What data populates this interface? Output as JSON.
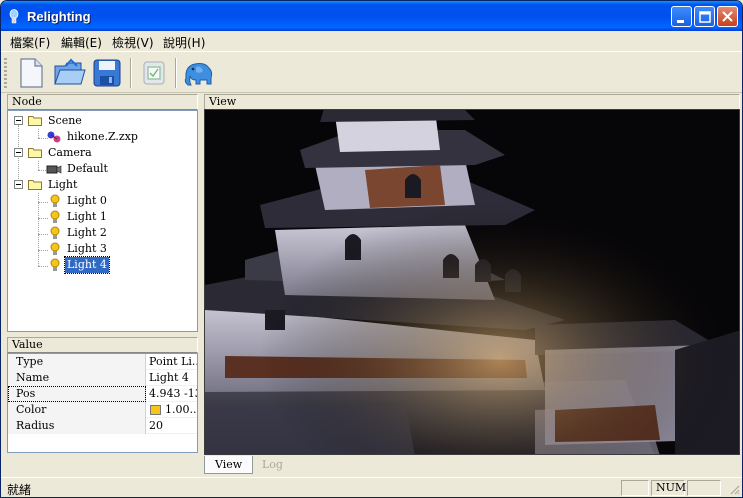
{
  "window": {
    "title": "Relighting"
  },
  "menu": {
    "items": [
      {
        "label": "檔案(F)"
      },
      {
        "label": "編輯(E)"
      },
      {
        "label": "檢視(V)"
      },
      {
        "label": "說明(H)"
      }
    ]
  },
  "toolbar": {
    "buttons": [
      "new-file-icon",
      "open-folder-icon",
      "save-disk-icon",
      "render-icon",
      "elephant-icon"
    ]
  },
  "node_panel": {
    "header": "Node",
    "tree": {
      "scene": {
        "label": "Scene",
        "children": [
          "hikone.Z.zxp"
        ]
      },
      "camera": {
        "label": "Camera",
        "children": [
          "Default"
        ]
      },
      "light": {
        "label": "Light",
        "children": [
          "Light 0",
          "Light 1",
          "Light 2",
          "Light 3",
          "Light 4"
        ],
        "selected": "Light 4"
      }
    }
  },
  "value_panel": {
    "header": "Value",
    "rows": [
      {
        "key": "Type",
        "value": "Point Li..."
      },
      {
        "key": "Name",
        "value": "Light 4"
      },
      {
        "key": "Pos",
        "value": "4.943 -13"
      },
      {
        "key": "Color",
        "value": "1.00...",
        "swatch": "#f5c518"
      },
      {
        "key": "Radius",
        "value": "20"
      }
    ]
  },
  "view_panel": {
    "header": "View",
    "tabs": [
      {
        "label": "View",
        "active": true
      },
      {
        "label": "Log",
        "active": false
      }
    ]
  },
  "status": {
    "text": "就緒",
    "indicator": "NUM"
  },
  "colors": {
    "titlebar": "#0053ee",
    "selection": "#316ac5",
    "chrome": "#ece9d8"
  }
}
